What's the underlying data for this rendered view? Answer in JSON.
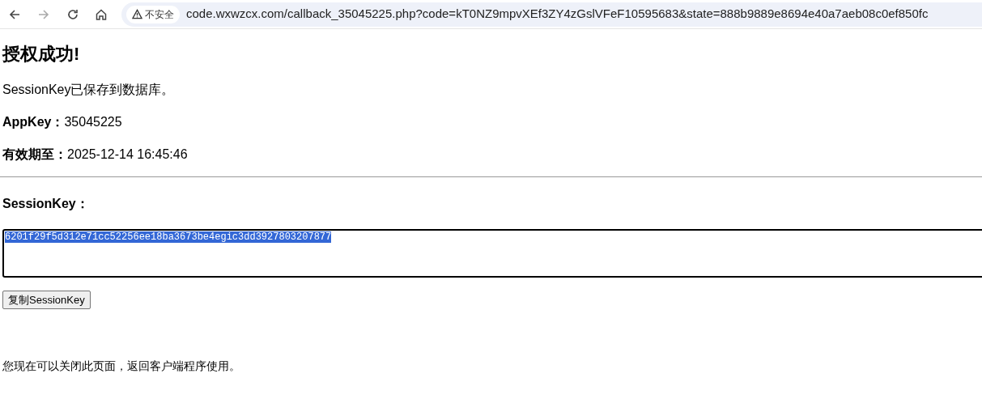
{
  "browser": {
    "security_label": "不安全",
    "url": "code.wxwzcx.com/callback_35045225.php?code=kT0NZ9mpvXEf3ZY4zGslVFeF10595683&state=888b9889e8694e40a7aeb08c0ef850fc"
  },
  "page": {
    "heading": "授权成功!",
    "saved_note": "SessionKey已保存到数据库。",
    "fields": [
      {
        "label": "AppKey：",
        "value": "35045225"
      },
      {
        "label": "有效期至：",
        "value": "2025-12-14 16:45:46"
      }
    ],
    "session_label": "SessionKey：",
    "session_box": {
      "value": "6201f29f5d312e71cc52256ee18ba3673be4egic3dd3927803207877",
      "selected": true
    },
    "copy_button": "复制SessionKey",
    "footer_note": "您现在可以关闭此页面，返回客户端程序使用。"
  }
}
